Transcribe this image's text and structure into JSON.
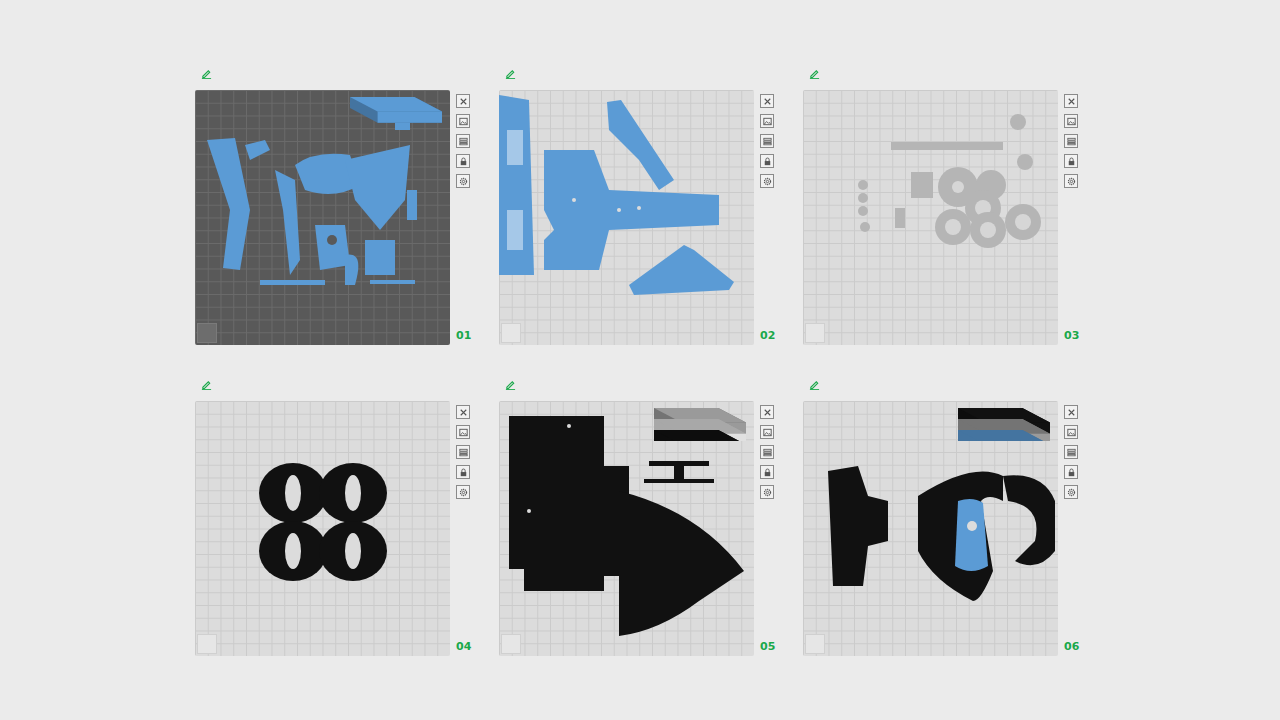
{
  "plates": [
    {
      "number": "01",
      "selected": true,
      "color": "#5b9bd5",
      "filaments": [
        "#5b9bd5"
      ]
    },
    {
      "number": "02",
      "selected": false,
      "color": "#5b9bd5",
      "filaments": []
    },
    {
      "number": "03",
      "selected": false,
      "color": "#b5b5b5",
      "filaments": []
    },
    {
      "number": "04",
      "selected": false,
      "color": "#111111",
      "filaments": []
    },
    {
      "number": "05",
      "selected": false,
      "color": "#111111",
      "filaments": [
        "#9a9a9a",
        "#e0e0e0",
        "#111111"
      ]
    },
    {
      "number": "06",
      "selected": false,
      "color": "#111111",
      "filaments": [
        "#111111",
        "#9a9a9a",
        "#5b9bd5"
      ]
    }
  ]
}
